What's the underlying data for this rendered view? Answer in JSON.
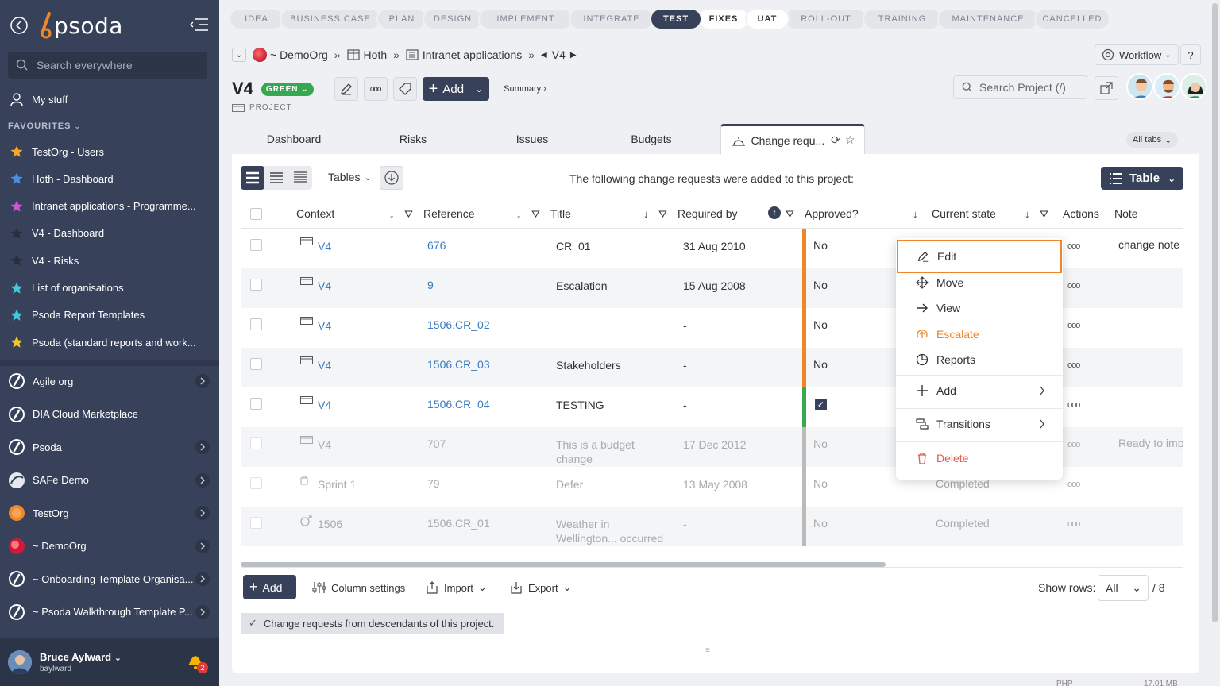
{
  "sidebar": {
    "logo_text": "psoda",
    "search_placeholder": "Search everywhere",
    "my_stuff": "My stuff",
    "favourites_heading": "FAVOURITES",
    "favourites": [
      {
        "label": "TestOrg - Users",
        "color": "#f5a623"
      },
      {
        "label": "Hoth - Dashboard",
        "color": "#4a90e2"
      },
      {
        "label": "Intranet applications - Programme...",
        "color": "#d84fd0"
      },
      {
        "label": "V4 - Dashboard",
        "color": "#2b2f3a"
      },
      {
        "label": "V4 - Risks",
        "color": "#2b2f3a"
      },
      {
        "label": "List of organisations",
        "color": "#42c8d8"
      },
      {
        "label": "Psoda Report Templates",
        "color": "#42c8d8"
      },
      {
        "label": "Psoda (standard reports and work...",
        "color": "#f5c623"
      }
    ],
    "orgs": [
      {
        "label": "Agile org",
        "chevron": true
      },
      {
        "label": "DIA Cloud Marketplace",
        "chevron": false
      },
      {
        "label": "Psoda",
        "chevron": true
      },
      {
        "label": "SAFe Demo",
        "chevron": true
      },
      {
        "label": "TestOrg",
        "chevron": true
      },
      {
        "label": "~ DemoOrg",
        "chevron": true
      },
      {
        "label": "~ Onboarding Template Organisa...",
        "chevron": true
      },
      {
        "label": "~ Psoda Walkthrough Template P...",
        "chevron": true
      }
    ],
    "user": {
      "name": "Bruce Aylward",
      "username": "baylward",
      "notifications": "2"
    }
  },
  "stages": [
    "IDEA",
    "BUSINESS CASE",
    "PLAN",
    "DESIGN",
    "IMPLEMENT",
    "INTEGRATE",
    "TEST",
    "FIXES",
    "UAT",
    "ROLL-OUT",
    "TRAINING",
    "MAINTENANCE",
    "CANCELLED"
  ],
  "active_stage": "TEST",
  "breadcrumb": {
    "org": "~ DemoOrg",
    "portfolio": "Hoth",
    "programme": "Intranet applications",
    "project": "V4",
    "sep": "»"
  },
  "workflow_label": "Workflow",
  "help_label": "?",
  "project": {
    "title": "V4",
    "status": "GREEN",
    "type": "PROJECT",
    "add_label": "Add",
    "summary_label": "Summary ›"
  },
  "project_search_placeholder": "Search Project (/)",
  "tabs": [
    "Dashboard",
    "Risks",
    "Issues",
    "Budgets",
    "Change requ..."
  ],
  "all_tabs_label": "All tabs",
  "toolbar": {
    "tables_label": "Tables",
    "intro": "The following change requests were added to this project:",
    "table_label": "Table"
  },
  "columns": [
    "Context",
    "Reference",
    "Title",
    "Required by",
    "Approved?",
    "Current state",
    "Actions",
    "Note"
  ],
  "rows": [
    {
      "context": "V4",
      "reference": "676",
      "title": "CR_01",
      "title2": "",
      "required_by": "31 Aug 2010",
      "approved": "No",
      "state": "",
      "note": "change note",
      "bar": "#f0862a",
      "dim": false,
      "ctx_icon": "project"
    },
    {
      "context": "V4",
      "reference": "9",
      "title": "Escalation",
      "title2": "",
      "required_by": "15 Aug 2008",
      "approved": "No",
      "state": "",
      "note": "",
      "bar": "#f0862a",
      "dim": false,
      "ctx_icon": "project"
    },
    {
      "context": "V4",
      "reference": "1506.CR_02",
      "title": "",
      "title2": "",
      "required_by": "-",
      "approved": "No",
      "state": "",
      "note": "",
      "bar": "#f0862a",
      "dim": false,
      "ctx_icon": "project"
    },
    {
      "context": "V4",
      "reference": "1506.CR_03",
      "title": "Stakeholders",
      "title2": "",
      "required_by": "-",
      "approved": "No",
      "state": "",
      "note": "",
      "bar": "#f0862a",
      "dim": false,
      "ctx_icon": "project"
    },
    {
      "context": "V4",
      "reference": "1506.CR_04",
      "title": "TESTING",
      "title2": "",
      "required_by": "-",
      "approved": "check",
      "state": "",
      "note": "",
      "bar": "#36a852",
      "dim": false,
      "ctx_icon": "project"
    },
    {
      "context": "V4",
      "reference": "707",
      "title": "This is a budget",
      "title2": "change",
      "required_by": "17 Dec 2012",
      "approved": "No",
      "state": "",
      "note": "Ready to imp",
      "bar": "#bbbbbb",
      "dim": true,
      "ctx_icon": "project"
    },
    {
      "context": "Sprint 1",
      "reference": "79",
      "title": "Defer",
      "title2": "",
      "required_by": "13 May 2008",
      "approved": "No",
      "state": "Completed",
      "note": "",
      "bar": "#bbbbbb",
      "dim": true,
      "ctx_icon": "sprint"
    },
    {
      "context": "1506",
      "reference": "1506.CR_01",
      "title": "Weather in",
      "title2": "Wellington... occurred",
      "required_by": "-",
      "approved": "No",
      "state": "Completed",
      "note": "",
      "bar": "#bbbbbb",
      "dim": true,
      "ctx_icon": "programme"
    }
  ],
  "actions_glyph": "ooo",
  "footer": {
    "add_label": "Add",
    "column_settings": "Column settings",
    "import": "Import",
    "export": "Export",
    "show_rows_label": "Show rows:",
    "show_rows_value": "All",
    "total": "/ 8",
    "descendants": "Change requests from descendants of this project."
  },
  "context_menu": [
    {
      "label": "Edit",
      "icon": "pencil-icon",
      "color": "#333333"
    },
    {
      "label": "Move",
      "icon": "move-icon",
      "color": "#333333"
    },
    {
      "label": "View",
      "icon": "arrow-right-icon",
      "color": "#333333"
    },
    {
      "label": "Escalate",
      "icon": "escalate-icon",
      "color": "#f0862a"
    },
    {
      "label": "Reports",
      "icon": "pie-chart-icon",
      "color": "#333333"
    },
    {
      "label": "Add",
      "icon": "plus-icon",
      "color": "#333333"
    },
    {
      "label": "Transitions",
      "icon": "transitions-icon",
      "color": "#333333"
    },
    {
      "label": "Delete",
      "icon": "trash-icon",
      "color": "#e05a4f"
    }
  ],
  "status_footer": {
    "left": "PHP",
    "right": "17.01 MB"
  }
}
